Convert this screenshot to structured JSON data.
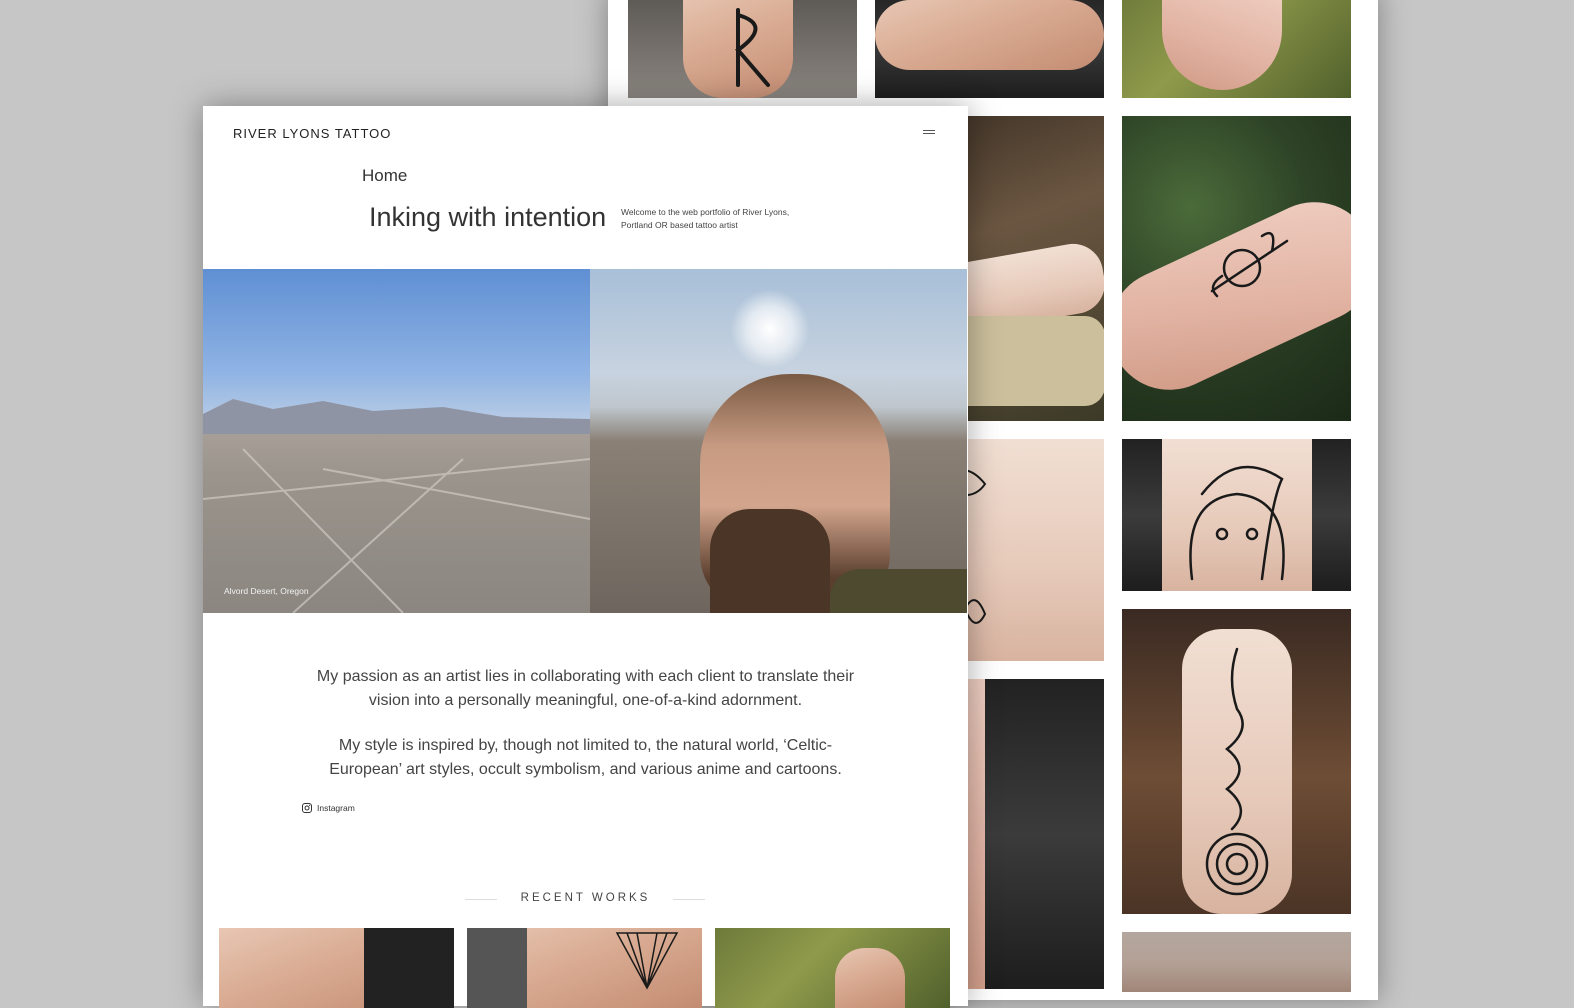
{
  "site": {
    "title": "RIVER LYONS TATTOO",
    "nav_home": "Home",
    "heading": "Inking with intention",
    "welcome": "Welcome to the web portfolio of River Lyons, Portland OR based tattoo artist"
  },
  "hero": {
    "caption": "Alvord Desert, Oregon"
  },
  "about": {
    "paragraph_1": "My passion as an artist lies in collaborating with each client to translate their vision into a personally meaningful, one-of-a-kind adornment.",
    "paragraph_2": "My style is inspired by, though not limited to, the natural world, ‘Celtic-European’ art styles, occult symbolism, and various anime and cartoons."
  },
  "social": {
    "instagram_label": "Instagram",
    "icon": "instagram-icon"
  },
  "recent_works": {
    "label": "RECENT WORKS"
  },
  "gallery": {
    "description_icons": [
      "rune-tattoo",
      "ankle-tattoo",
      "foot-tattoo",
      "leg-tattoo",
      "forearm-symbol-tattoo",
      "animals-tattoo",
      "totoro-tattoo",
      "rune-arm-tattoo",
      "lizard-spiral-tattoo"
    ]
  },
  "colors": {
    "page_bg": "#c6c6c6",
    "text": "#444444"
  }
}
